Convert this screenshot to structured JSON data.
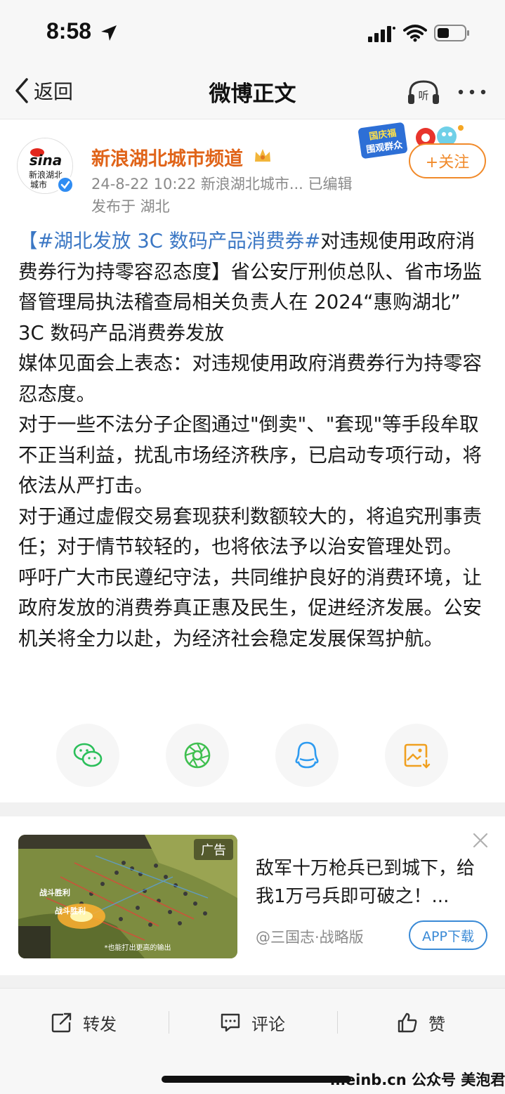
{
  "status": {
    "time": "8:58"
  },
  "nav": {
    "back_label": "返回",
    "title": "微博正文"
  },
  "author": {
    "name": "新浪湖北城市频道",
    "avatar_text_1": "sina",
    "avatar_text_2": "新浪湖北",
    "avatar_text_3": "城市",
    "meta": "24-8-22 10:22  新浪湖北城市...  已编辑",
    "location": "发布于 湖北",
    "follow_label": "+关注",
    "sticker_text_1": "国庆福",
    "sticker_text_2": "围观群众"
  },
  "post": {
    "hashtag": "【#湖北发放 3C 数码产品消费券#",
    "p1_rest": "对违规使用政府消费券行为持零容忍态度】省公安厅刑侦总队、省市场监督管理局执法稽查局相关负责人在 2024“惠购湖北” 3C 数码产品消费券发放",
    "p2": "媒体见面会上表态：对违规使用政府消费券行为持零容忍态度。",
    "p3": "对于一些不法分子企图通过\"倒卖\"、\"套现\"等手段牟取不正当利益，扰乱市场经济秩序，已启动专项行动，将依法从严打击。",
    "p4": "对于通过虚假交易套现获利数额较大的，将追究刑事责任；对于情节较轻的，也将依法予以治安管理处罚。",
    "p5": "呼吁广大市民遵纪守法，共同维护良好的消费环境，让政府发放的消费券真正惠及民生，促进经济发展。公安机关将全力以赴，为经济社会稳定发展保驾护航。"
  },
  "share": {
    "icons": [
      "wechat-icon",
      "moments-icon",
      "qq-icon",
      "save-image-icon"
    ],
    "colors": {
      "wechat": "#2bbf5a",
      "moments": "#3fbf4f",
      "qq": "#2e9bf0",
      "save": "#f0a020"
    }
  },
  "ad": {
    "tag": "广告",
    "headline": "敌军十万枪兵已到城下，给我1万弓兵即可破之！...",
    "source": "@三国志·战略版",
    "download_label": "APP下载",
    "image_caption": "*也能打出更高的输出",
    "image_badge_1": "战斗胜利",
    "image_badge_2": "战斗胜利"
  },
  "actions": {
    "repost": "转发",
    "comment": "评论",
    "like": "赞"
  },
  "watermark": "meinb.cn  公众号 美泡君",
  "colors": {
    "accent_orange": "#e06419",
    "link_blue": "#3b77c4",
    "follow": "#f18a2a"
  }
}
